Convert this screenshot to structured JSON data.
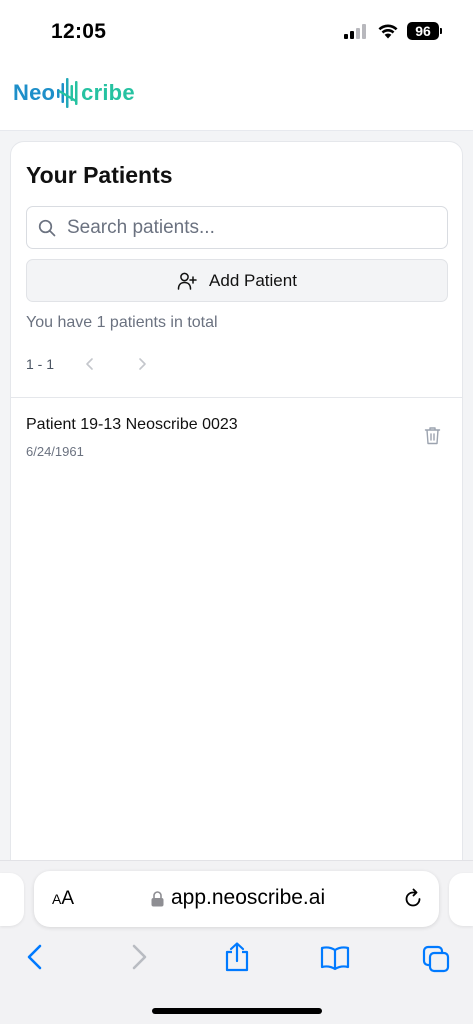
{
  "status_bar": {
    "time": "12:05",
    "battery": "96"
  },
  "header": {
    "logo_part1": "Neo",
    "logo_part2": "cribe"
  },
  "patients": {
    "title": "Your Patients",
    "search_placeholder": "Search patients...",
    "add_label": "Add Patient",
    "total_text": "You have 1 patients in total",
    "pager_range": "1 - 1",
    "list": [
      {
        "name": "Patient 19-13 Neoscribe 0023",
        "dob": "6/24/1961"
      }
    ]
  },
  "browser": {
    "aa_label_big": "A",
    "aa_label_small": "A",
    "url": "app.neoscribe.ai"
  },
  "colors": {
    "accent_blue": "#007aff",
    "logo_blue": "#1e8fc9",
    "logo_green": "#26c2a1"
  }
}
